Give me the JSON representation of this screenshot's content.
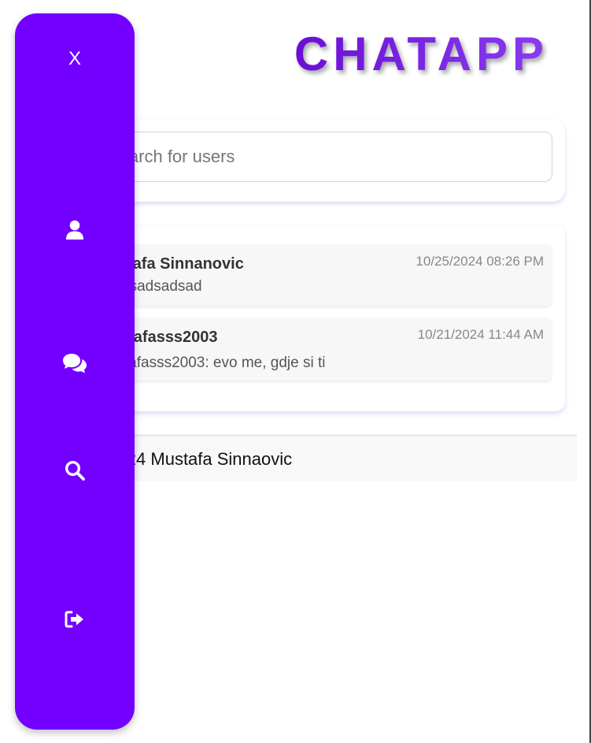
{
  "app": {
    "title": "CHATAPP"
  },
  "sidebar": {
    "close_label": "X",
    "items": [
      {
        "name": "profile",
        "icon": "user-icon"
      },
      {
        "name": "chats",
        "icon": "comments-icon"
      },
      {
        "name": "search",
        "icon": "search-icon"
      },
      {
        "name": "logout",
        "icon": "sign-out-icon"
      }
    ]
  },
  "search": {
    "placeholder": "Search for users",
    "value": ""
  },
  "chats": [
    {
      "name": "Mustafa Sinnanovic",
      "message": "You: sadsadsad",
      "time": "10/25/2024 08:26 PM"
    },
    {
      "name": "mustafasss2003",
      "message": "mustafasss2003: evo me, gdje si ti",
      "time": "10/21/2024 11:44 AM"
    }
  ],
  "footer": {
    "text": "© 2024 Mustafa Sinnaovic"
  },
  "colors": {
    "sidebar": "#7300ff",
    "title_gradient_start": "#6a0fd6",
    "title_gradient_end": "#8a3bf0"
  }
}
